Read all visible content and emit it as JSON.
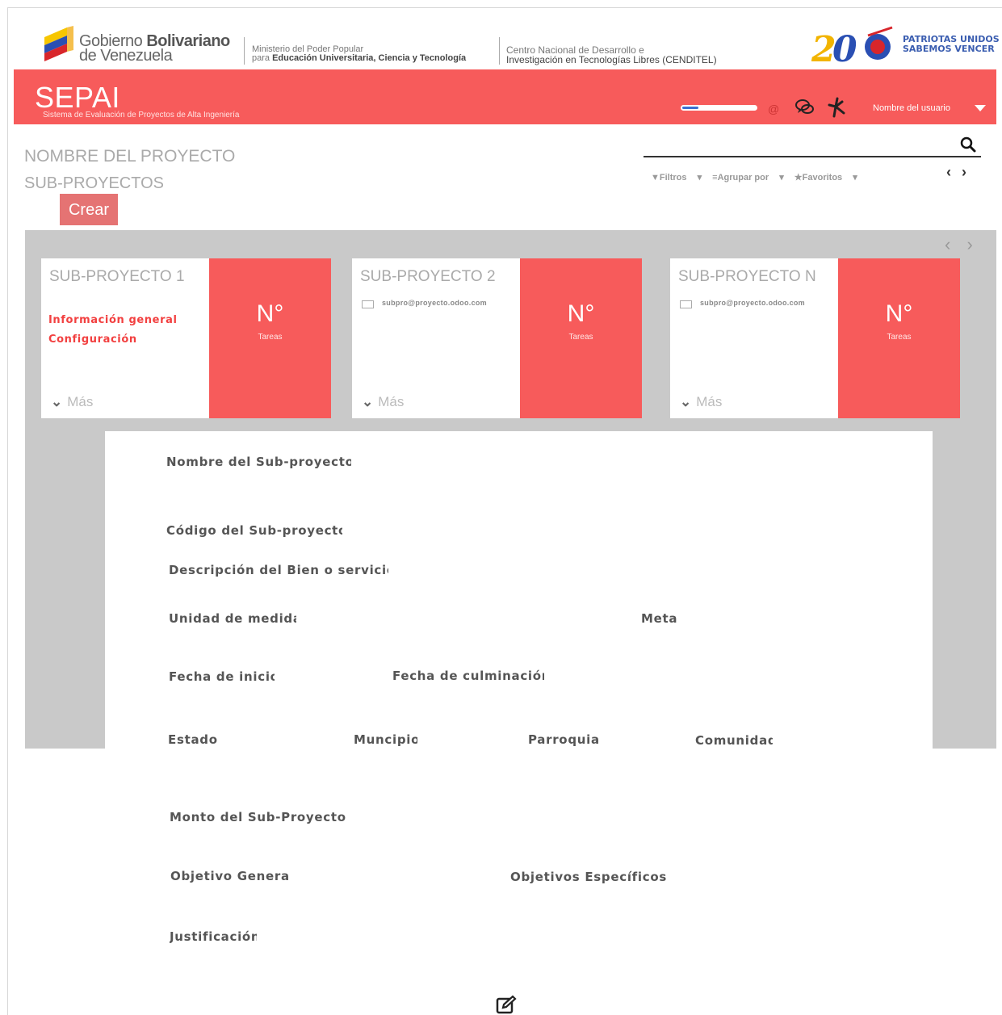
{
  "gov": {
    "name_light": "Gobierno ",
    "name_bold": "Bolivariano",
    "name_line2": "de Venezuela",
    "ministry_line1": "Ministerio del Poder Popular",
    "ministry_line2_prefix": "para ",
    "ministry_line2_bold": "Educación Universitaria, Ciencia y Tecnología",
    "cenditel_line1": "Centro Nacional de Desarrollo e",
    "cenditel_line2": "Investigación en Tecnologías Libres (CENDITEL)",
    "badge_line1": "PATRIOTAS UNIDOS",
    "badge_line2": "SABEMOS VENCER"
  },
  "topbar": {
    "title": "SEPAI",
    "subtitle": "Sistema de Evaluación de Proyectos de Alta Ingeniería",
    "progress_fraction": 0.22,
    "at_symbol": "@",
    "user_name": "Nombre del usuario",
    "accent_color": "#f75b5b"
  },
  "header": {
    "project_name": "NOMBRE DEL PROYECTO",
    "subprojects_label": "SUB-PROYECTOS",
    "create_label": "Crear"
  },
  "search": {
    "filters": "Filtros",
    "group_by": "Agrupar por",
    "favorites": "Favoritos"
  },
  "cards": [
    {
      "title": "SUB-PROYECTO 1",
      "link1": "Información general",
      "link2": "Configuración",
      "number": "N°",
      "number_label": "Tareas",
      "more": "Más"
    },
    {
      "title": "SUB-PROYECTO 2",
      "email": "subpro@proyecto.odoo.com",
      "number": "N°",
      "number_label": "Tareas",
      "more": "Más"
    },
    {
      "title": "SUB-PROYECTO N",
      "email": "subpro@proyecto.odoo.com",
      "number": "N°",
      "number_label": "Tareas",
      "more": "Más"
    }
  ],
  "form": {
    "nombre": "Nombre del Sub-proyecto",
    "codigo": "Código del Sub-proyecto",
    "descripcion": "Descripción del Bien o servicio",
    "unidad": "Unidad de medida",
    "meta": "Meta",
    "fecha_inicio": "Fecha de inicio",
    "fecha_culminacion": "Fecha de culminación",
    "estado": "Estado",
    "municipio": "Muncipio",
    "parroquia": "Parroquia",
    "comunidad": "Comunidad",
    "monto": "Monto del Sub-Proyecto",
    "objetivo_general": "Objetivo General",
    "objetivos_especificos": "Objetivos Específicos",
    "justificacion": "Justificación"
  }
}
